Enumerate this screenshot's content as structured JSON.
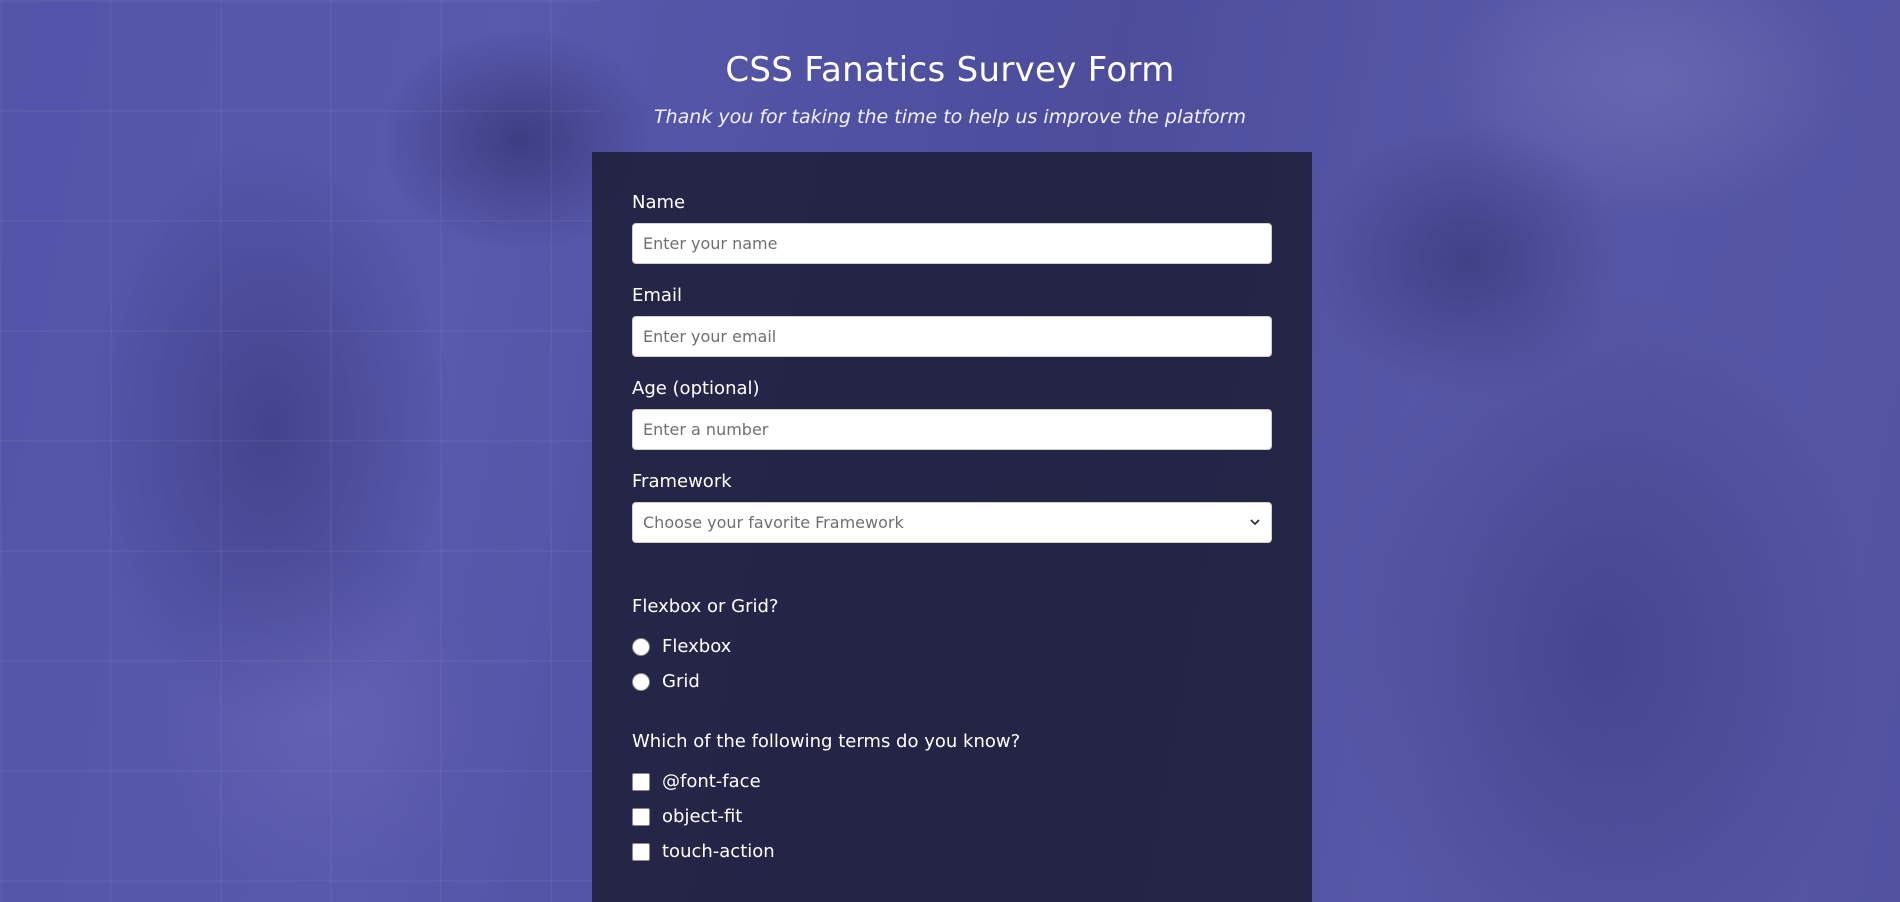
{
  "header": {
    "title": "CSS Fanatics Survey Form",
    "subtitle": "Thank you for taking the time to help us improve the platform"
  },
  "form": {
    "name": {
      "label": "Name",
      "placeholder": "Enter your name",
      "value": ""
    },
    "email": {
      "label": "Email",
      "placeholder": "Enter your email",
      "value": ""
    },
    "age": {
      "label": "Age (optional)",
      "placeholder": "Enter a number",
      "value": ""
    },
    "framework": {
      "label": "Framework",
      "selected": "Choose your favorite Framework"
    },
    "layout": {
      "question": "Flexbox or Grid?",
      "options": [
        "Flexbox",
        "Grid"
      ]
    },
    "terms": {
      "question": "Which of the following terms do you know?",
      "options": [
        "@font-face",
        "object-fit",
        "touch-action"
      ]
    }
  }
}
